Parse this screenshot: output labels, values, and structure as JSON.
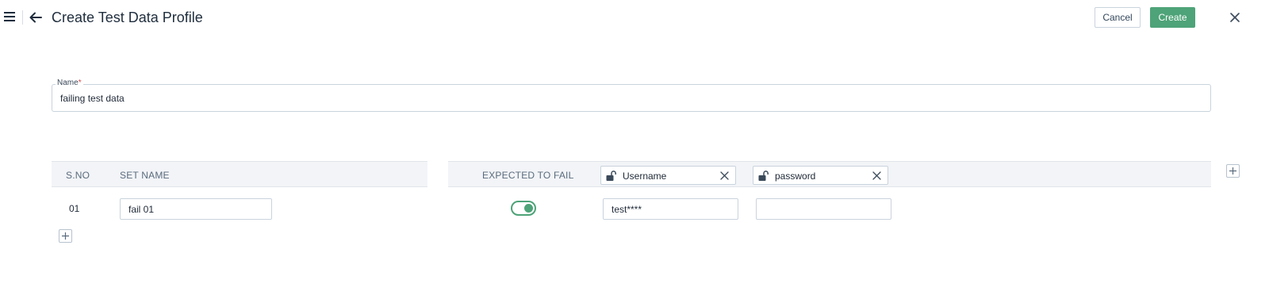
{
  "header": {
    "title": "Create Test Data Profile",
    "cancel_label": "Cancel",
    "create_label": "Create"
  },
  "form": {
    "name_label": "Name",
    "required_mark": "*",
    "name_value": "failing test data"
  },
  "table": {
    "columns": {
      "sno": "S.NO",
      "set_name": "SET NAME",
      "expected_to_fail": "EXPECTED TO FAIL"
    },
    "parameters": [
      {
        "label": "Username",
        "icon": "unlock-icon"
      },
      {
        "label": "password",
        "icon": "unlock-icon"
      }
    ],
    "rows": [
      {
        "sno": "01",
        "set_name": "fail 01",
        "expected_to_fail": true,
        "values": [
          "test****",
          ""
        ]
      }
    ]
  },
  "colors": {
    "accent": "#4ea378",
    "header_bg": "#f2f4f7",
    "border": "#c9d3dd"
  }
}
